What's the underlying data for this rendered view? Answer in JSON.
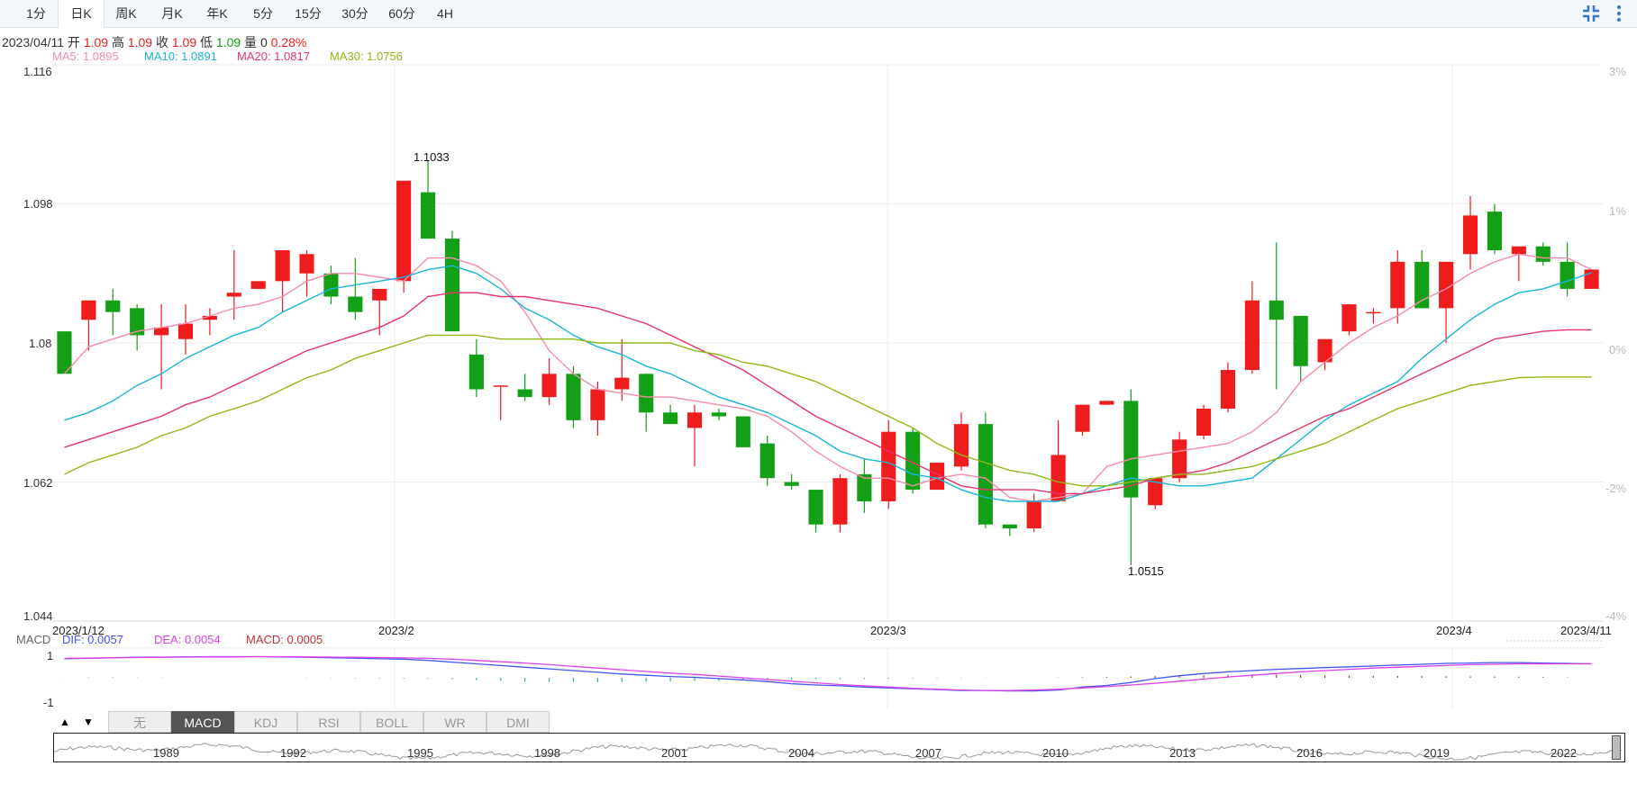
{
  "tabs": [
    {
      "label": "1分",
      "active": false
    },
    {
      "label": "日K",
      "active": true
    },
    {
      "label": "周K",
      "active": false
    },
    {
      "label": "月K",
      "active": false
    },
    {
      "label": "年K",
      "active": false
    },
    {
      "label": "5分",
      "active": false
    },
    {
      "label": "15分",
      "active": false
    },
    {
      "label": "30分",
      "active": false
    },
    {
      "label": "60分",
      "active": false
    },
    {
      "label": "4H",
      "active": false
    }
  ],
  "info": {
    "date": "2023/04/11",
    "open_label": "开",
    "open": "1.09",
    "high_label": "高",
    "high": "1.09",
    "close_label": "收",
    "close": "1.09",
    "low_label": "低",
    "low": "1.09",
    "vol_label": "量",
    "vol": "0",
    "change": "0.28%"
  },
  "ma": {
    "ma5": "MA5: 1.0895",
    "ma10": "MA10: 1.0891",
    "ma20": "MA20: 1.0817",
    "ma30": "MA30: 1.0756"
  },
  "y_ticks": [
    "1.116",
    "1.098",
    "1.08",
    "1.062",
    "1.044"
  ],
  "pct_ticks": [
    "3%",
    "1%",
    "0%",
    "-2%",
    "-4%"
  ],
  "x_ticks": [
    "2023/1/12",
    "2023/2",
    "2023/3",
    "2023/4",
    "2023/4/11"
  ],
  "annotations": {
    "max_label": "1.1033",
    "min_label": "1.0515"
  },
  "macd": {
    "title": "MACD",
    "dif": "DIF: 0.0057",
    "dea": "DEA: 0.0054",
    "macd": "MACD: 0.0005",
    "tick_top": "1",
    "tick_bottom": "-1"
  },
  "indicators": [
    "无",
    "MACD",
    "KDJ",
    "RSI",
    "BOLL",
    "WR",
    "DMI"
  ],
  "active_indicator": "MACD",
  "arrows": {
    "up": "▲",
    "down": "▼"
  },
  "navigator_years": [
    "1989",
    "1992",
    "1995",
    "1998",
    "2001",
    "2004",
    "2007",
    "2010",
    "2013",
    "2016",
    "2019",
    "2022"
  ],
  "colors": {
    "up": "#ee1c1c",
    "down": "#13a016",
    "ma5": "#f48cab",
    "ma10": "#1ab6d8",
    "ma20": "#e8336e",
    "ma30": "#90b816",
    "dif": "#4455ee",
    "dea": "#e040e8",
    "accent": "#3b73c8"
  },
  "chart_data": {
    "type": "candlestick",
    "title": "",
    "ylim": [
      1.044,
      1.116
    ],
    "y_ticks": [
      1.116,
      1.098,
      1.08,
      1.062,
      1.044
    ],
    "x_ticks": [
      "2023/1/12",
      "2023/2",
      "2023/3",
      "2023/4",
      "2023/4/11"
    ],
    "candles": [
      {
        "o": 1.0815,
        "h": 1.0815,
        "l": 1.0765,
        "c": 1.076
      },
      {
        "o": 1.083,
        "h": 1.085,
        "l": 1.079,
        "c": 1.0855
      },
      {
        "o": 1.0855,
        "h": 1.087,
        "l": 1.081,
        "c": 1.084
      },
      {
        "o": 1.0845,
        "h": 1.085,
        "l": 1.079,
        "c": 1.081
      },
      {
        "o": 1.081,
        "h": 1.085,
        "l": 1.074,
        "c": 1.082
      },
      {
        "o": 1.0805,
        "h": 1.085,
        "l": 1.0785,
        "c": 1.0825
      },
      {
        "o": 1.083,
        "h": 1.0845,
        "l": 1.081,
        "c": 1.0835
      },
      {
        "o": 1.086,
        "h": 1.092,
        "l": 1.083,
        "c": 1.0865
      },
      {
        "o": 1.087,
        "h": 1.088,
        "l": 1.087,
        "c": 1.088
      },
      {
        "o": 1.088,
        "h": 1.09,
        "l": 1.084,
        "c": 1.092
      },
      {
        "o": 1.089,
        "h": 1.092,
        "l": 1.086,
        "c": 1.0915
      },
      {
        "o": 1.089,
        "h": 1.09,
        "l": 1.085,
        "c": 1.086
      },
      {
        "o": 1.086,
        "h": 1.091,
        "l": 1.083,
        "c": 1.084
      },
      {
        "o": 1.0855,
        "h": 1.087,
        "l": 1.081,
        "c": 1.087
      },
      {
        "o": 1.088,
        "h": 1.099,
        "l": 1.0865,
        "c": 1.101
      },
      {
        "o": 1.0995,
        "h": 1.1033,
        "l": 1.0935,
        "c": 1.0935
      },
      {
        "o": 1.0935,
        "h": 1.0945,
        "l": 1.0815,
        "c": 1.0815
      },
      {
        "o": 1.0785,
        "h": 1.0805,
        "l": 1.073,
        "c": 1.074
      },
      {
        "o": 1.0745,
        "h": 1.0745,
        "l": 1.07,
        "c": 1.0745
      },
      {
        "o": 1.074,
        "h": 1.076,
        "l": 1.0725,
        "c": 1.073
      },
      {
        "o": 1.073,
        "h": 1.078,
        "l": 1.072,
        "c": 1.076
      },
      {
        "o": 1.076,
        "h": 1.077,
        "l": 1.069,
        "c": 1.07
      },
      {
        "o": 1.07,
        "h": 1.075,
        "l": 1.068,
        "c": 1.074
      },
      {
        "o": 1.074,
        "h": 1.0805,
        "l": 1.0725,
        "c": 1.0755
      },
      {
        "o": 1.076,
        "h": 1.076,
        "l": 1.0685,
        "c": 1.071
      },
      {
        "o": 1.071,
        "h": 1.072,
        "l": 1.07,
        "c": 1.0695
      },
      {
        "o": 1.069,
        "h": 1.072,
        "l": 1.064,
        "c": 1.071
      },
      {
        "o": 1.071,
        "h": 1.0715,
        "l": 1.07,
        "c": 1.0705
      },
      {
        "o": 1.0705,
        "h": 1.07,
        "l": 1.0665,
        "c": 1.0665
      },
      {
        "o": 1.067,
        "h": 1.068,
        "l": 1.0615,
        "c": 1.0625
      },
      {
        "o": 1.062,
        "h": 1.063,
        "l": 1.061,
        "c": 1.0615
      },
      {
        "o": 1.061,
        "h": 1.059,
        "l": 1.0555,
        "c": 1.0565
      },
      {
        "o": 1.0565,
        "h": 1.063,
        "l": 1.0555,
        "c": 1.0625
      },
      {
        "o": 1.063,
        "h": 1.065,
        "l": 1.058,
        "c": 1.0595
      },
      {
        "o": 1.0595,
        "h": 1.07,
        "l": 1.0585,
        "c": 1.0685
      },
      {
        "o": 1.0685,
        "h": 1.069,
        "l": 1.0605,
        "c": 1.061
      },
      {
        "o": 1.061,
        "h": 1.0645,
        "l": 1.061,
        "c": 1.0645
      },
      {
        "o": 1.064,
        "h": 1.071,
        "l": 1.0635,
        "c": 1.0695
      },
      {
        "o": 1.0695,
        "h": 1.071,
        "l": 1.056,
        "c": 1.0565
      },
      {
        "o": 1.0565,
        "h": 1.0565,
        "l": 1.055,
        "c": 1.056
      },
      {
        "o": 1.056,
        "h": 1.0605,
        "l": 1.0555,
        "c": 1.0595
      },
      {
        "o": 1.0595,
        "h": 1.07,
        "l": 1.0595,
        "c": 1.0655
      },
      {
        "o": 1.0685,
        "h": 1.072,
        "l": 1.068,
        "c": 1.072
      },
      {
        "o": 1.072,
        "h": 1.0725,
        "l": 1.0725,
        "c": 1.0725
      },
      {
        "o": 1.0725,
        "h": 1.074,
        "l": 1.0515,
        "c": 1.06
      },
      {
        "o": 1.059,
        "h": 1.0625,
        "l": 1.0585,
        "c": 1.0625
      },
      {
        "o": 1.0625,
        "h": 1.0685,
        "l": 1.062,
        "c": 1.0675
      },
      {
        "o": 1.068,
        "h": 1.072,
        "l": 1.0675,
        "c": 1.0715
      },
      {
        "o": 1.0715,
        "h": 1.0775,
        "l": 1.071,
        "c": 1.0765
      },
      {
        "o": 1.0765,
        "h": 1.088,
        "l": 1.076,
        "c": 1.0855
      },
      {
        "o": 1.0855,
        "h": 1.093,
        "l": 1.074,
        "c": 1.083
      },
      {
        "o": 1.0835,
        "h": 1.0835,
        "l": 1.075,
        "c": 1.077
      },
      {
        "o": 1.0775,
        "h": 1.0805,
        "l": 1.0765,
        "c": 1.0805
      },
      {
        "o": 1.0815,
        "h": 1.0845,
        "l": 1.081,
        "c": 1.085
      },
      {
        "o": 1.084,
        "h": 1.0845,
        "l": 1.0825,
        "c": 1.084
      },
      {
        "o": 1.0845,
        "h": 1.092,
        "l": 1.0825,
        "c": 1.0905
      },
      {
        "o": 1.0905,
        "h": 1.092,
        "l": 1.086,
        "c": 1.0845
      },
      {
        "o": 1.0845,
        "h": 1.09,
        "l": 1.08,
        "c": 1.0905
      },
      {
        "o": 1.0915,
        "h": 1.099,
        "l": 1.0895,
        "c": 1.0965
      },
      {
        "o": 1.097,
        "h": 1.098,
        "l": 1.0915,
        "c": 1.092
      },
      {
        "o": 1.0915,
        "h": 1.0915,
        "l": 1.088,
        "c": 1.0925
      },
      {
        "o": 1.0925,
        "h": 1.093,
        "l": 1.09,
        "c": 1.0905
      },
      {
        "o": 1.0905,
        "h": 1.093,
        "l": 1.086,
        "c": 1.087
      },
      {
        "o": 1.087,
        "h": 1.0895,
        "l": 1.0875,
        "c": 1.0895
      }
    ],
    "series": [
      {
        "name": "MA5",
        "values": [
          1.076,
          1.0795,
          1.0805,
          1.0815,
          1.082,
          1.0825,
          1.0835,
          1.0845,
          1.085,
          1.086,
          1.088,
          1.089,
          1.089,
          1.0885,
          1.088,
          1.091,
          1.091,
          1.09,
          1.088,
          1.084,
          1.079,
          1.076,
          1.074,
          1.0735,
          1.073,
          1.073,
          1.0725,
          1.072,
          1.0715,
          1.0705,
          1.0685,
          1.066,
          1.064,
          1.0625,
          1.0625,
          1.0615,
          1.0625,
          1.063,
          1.0625,
          1.06,
          1.0595,
          1.06,
          1.0605,
          1.064,
          1.065,
          1.0655,
          1.066,
          1.0665,
          1.067,
          1.0685,
          1.071,
          1.075,
          1.0775,
          1.08,
          1.082,
          1.0835,
          1.0855,
          1.087,
          1.089,
          1.0905,
          1.0915,
          1.091,
          1.091,
          1.0895
        ]
      },
      {
        "name": "MA10",
        "values": [
          1.07,
          1.071,
          1.0725,
          1.0745,
          1.076,
          1.078,
          1.0795,
          1.081,
          1.082,
          1.084,
          1.0855,
          1.087,
          1.0875,
          1.088,
          1.0885,
          1.0895,
          1.09,
          1.089,
          1.087,
          1.0845,
          1.083,
          1.081,
          1.0795,
          1.0785,
          1.077,
          1.076,
          1.0745,
          1.073,
          1.072,
          1.071,
          1.0695,
          1.068,
          1.066,
          1.065,
          1.0645,
          1.063,
          1.0625,
          1.061,
          1.06,
          1.0595,
          1.0595,
          1.0595,
          1.0605,
          1.0615,
          1.0625,
          1.062,
          1.0615,
          1.0615,
          1.062,
          1.0625,
          1.065,
          1.0675,
          1.07,
          1.072,
          1.0735,
          1.075,
          1.078,
          1.0805,
          1.083,
          1.085,
          1.0865,
          1.087,
          1.088,
          1.0891
        ]
      },
      {
        "name": "MA20",
        "values": [
          1.0665,
          1.0675,
          1.0685,
          1.0695,
          1.0705,
          1.072,
          1.073,
          1.0745,
          1.076,
          1.0775,
          1.079,
          1.08,
          1.081,
          1.082,
          1.0835,
          1.086,
          1.0865,
          1.0865,
          1.086,
          1.086,
          1.0855,
          1.085,
          1.0845,
          1.0835,
          1.0825,
          1.081,
          1.0795,
          1.078,
          1.0765,
          1.0745,
          1.0725,
          1.0705,
          1.069,
          1.0675,
          1.066,
          1.0645,
          1.063,
          1.0615,
          1.061,
          1.061,
          1.061,
          1.0605,
          1.0605,
          1.061,
          1.0615,
          1.0625,
          1.063,
          1.0635,
          1.0645,
          1.066,
          1.0675,
          1.069,
          1.0705,
          1.0715,
          1.073,
          1.0745,
          1.076,
          1.0775,
          1.079,
          1.0805,
          1.081,
          1.0815,
          1.0817,
          1.0817
        ]
      },
      {
        "name": "MA30",
        "values": [
          1.063,
          1.0645,
          1.0655,
          1.0665,
          1.068,
          1.069,
          1.0705,
          1.0715,
          1.0725,
          1.074,
          1.0755,
          1.0765,
          1.078,
          1.079,
          1.08,
          1.081,
          1.081,
          1.081,
          1.0805,
          1.0805,
          1.0805,
          1.0805,
          1.08,
          1.08,
          1.08,
          1.08,
          1.079,
          1.0785,
          1.0775,
          1.077,
          1.076,
          1.075,
          1.0735,
          1.072,
          1.0705,
          1.069,
          1.067,
          1.0655,
          1.0645,
          1.0635,
          1.063,
          1.062,
          1.0615,
          1.0615,
          1.062,
          1.0625,
          1.063,
          1.063,
          1.0635,
          1.064,
          1.065,
          1.066,
          1.067,
          1.0685,
          1.07,
          1.0715,
          1.0725,
          1.0735,
          1.0745,
          1.075,
          1.0755,
          1.0756,
          1.0756,
          1.0756
        ]
      }
    ],
    "macd_panel": {
      "ylim": [
        -1,
        1
      ],
      "dif": [
        0.9,
        0.92,
        0.95,
        0.97,
        0.98,
        0.99,
        1.0,
        1.0,
        1.0,
        0.99,
        0.97,
        0.95,
        0.93,
        0.9,
        0.88,
        0.82,
        0.74,
        0.66,
        0.58,
        0.5,
        0.42,
        0.34,
        0.26,
        0.18,
        0.12,
        0.06,
        0.02,
        -0.04,
        -0.1,
        -0.18,
        -0.28,
        -0.34,
        -0.38,
        -0.44,
        -0.48,
        -0.52,
        -0.56,
        -0.6,
        -0.6,
        -0.62,
        -0.62,
        -0.58,
        -0.44,
        -0.36,
        -0.22,
        -0.04,
        0.1,
        0.2,
        0.28,
        0.34,
        0.4,
        0.44,
        0.48,
        0.52,
        0.56,
        0.6,
        0.64,
        0.68,
        0.7,
        0.72,
        0.72,
        0.7,
        0.68,
        0.66
      ],
      "dea": [
        0.92,
        0.93,
        0.95,
        0.96,
        0.97,
        0.98,
        0.99,
        0.99,
        1.0,
        1.0,
        0.99,
        0.98,
        0.97,
        0.96,
        0.94,
        0.92,
        0.88,
        0.82,
        0.76,
        0.7,
        0.62,
        0.54,
        0.46,
        0.38,
        0.3,
        0.22,
        0.16,
        0.08,
        0.0,
        -0.08,
        -0.16,
        -0.24,
        -0.32,
        -0.38,
        -0.44,
        -0.5,
        -0.54,
        -0.58,
        -0.6,
        -0.6,
        -0.58,
        -0.54,
        -0.48,
        -0.42,
        -0.34,
        -0.26,
        -0.16,
        -0.06,
        0.04,
        0.12,
        0.2,
        0.28,
        0.34,
        0.4,
        0.46,
        0.5,
        0.54,
        0.58,
        0.62,
        0.64,
        0.66,
        0.66,
        0.66,
        0.66
      ],
      "hist": [
        0.02,
        0.04,
        0.05,
        0.04,
        0.03,
        0.02,
        0.01,
        0.0,
        0.0,
        -0.02,
        -0.04,
        -0.06,
        -0.08,
        -0.1,
        -0.12,
        -0.14,
        -0.2,
        -0.3,
        -0.4,
        -0.5,
        -0.55,
        -0.58,
        -0.6,
        -0.58,
        -0.55,
        -0.5,
        -0.45,
        -0.4,
        -0.35,
        -0.3,
        -0.25,
        -0.2,
        -0.18,
        -0.15,
        -0.12,
        -0.1,
        -0.08,
        -0.06,
        -0.04,
        -0.02,
        0.0,
        0.04,
        0.08,
        0.12,
        0.18,
        0.24,
        0.3,
        0.35,
        0.4,
        0.45,
        0.42,
        0.38,
        0.34,
        0.3,
        0.28,
        0.26,
        0.24,
        0.22,
        0.2,
        0.18,
        0.16,
        0.1,
        0.06,
        0.02
      ]
    }
  }
}
